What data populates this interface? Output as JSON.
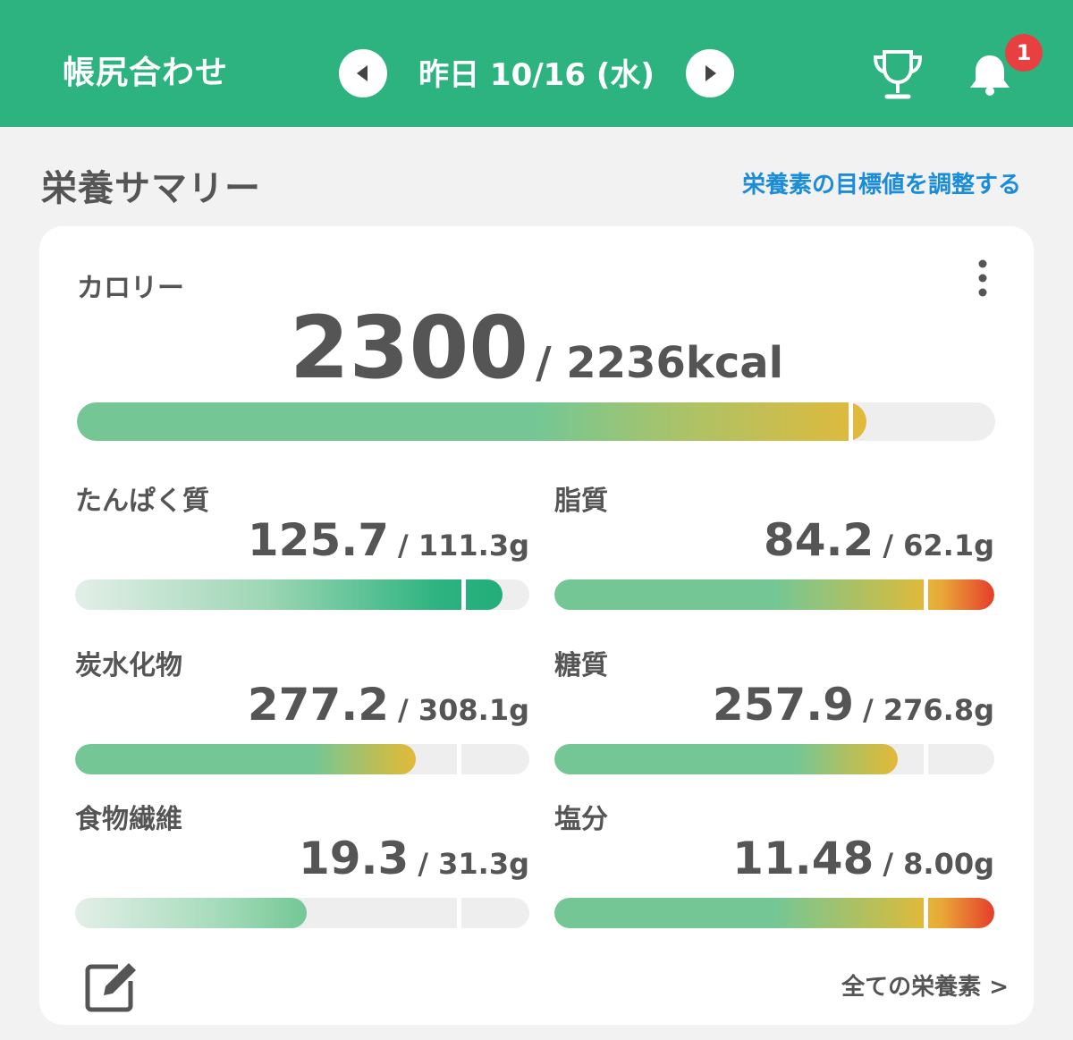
{
  "header": {
    "title": "帳尻合わせ",
    "date": "昨日 10/16 (水)",
    "notification_count": "1"
  },
  "summary": {
    "title": "栄養サマリー",
    "adjust_link": "栄養素の目標値を調整する"
  },
  "calorie": {
    "label": "カロリー",
    "value": "2300",
    "goal": "/ 2236kcal",
    "progress_fraction": 0.86,
    "marker_fraction": 0.84
  },
  "nutrients": [
    {
      "label": "たんぱく質",
      "value": "125.7",
      "goal": "/ 111.3g",
      "progress_fraction": 0.94,
      "marker_fraction": 0.85,
      "style": "protein"
    },
    {
      "label": "脂質",
      "value": "84.2",
      "goal": "/ 62.1g",
      "progress_fraction": 1.0,
      "marker_fraction": 0.84,
      "style": "over"
    },
    {
      "label": "炭水化物",
      "value": "277.2",
      "goal": "/ 308.1g",
      "progress_fraction": 0.75,
      "marker_fraction": 0.84,
      "style": "normal"
    },
    {
      "label": "糖質",
      "value": "257.9",
      "goal": "/ 276.8g",
      "progress_fraction": 0.78,
      "marker_fraction": 0.84,
      "style": "normal"
    },
    {
      "label": "食物繊維",
      "value": "19.3",
      "goal": "/ 31.3g",
      "progress_fraction": 0.51,
      "marker_fraction": 0.84,
      "style": "fiber"
    },
    {
      "label": "塩分",
      "value": "11.48",
      "goal": "/ 8.00g",
      "progress_fraction": 1.0,
      "marker_fraction": 0.84,
      "style": "over"
    }
  ],
  "footer": {
    "all_nutrients_link": "全ての栄養素 >"
  },
  "icons": {
    "prev": "chevron-left-icon",
    "next": "chevron-right-icon",
    "trophy": "trophy-icon",
    "bell": "bell-icon",
    "menu": "more-vertical-icon",
    "edit": "edit-icon"
  },
  "colors": {
    "brand_green": "#2db37f",
    "link_blue": "#1a8cd8",
    "badge_red": "#e84040",
    "bar_green": "#74c795",
    "bar_yellow": "#e2b93a",
    "bar_red": "#e63d2a"
  }
}
